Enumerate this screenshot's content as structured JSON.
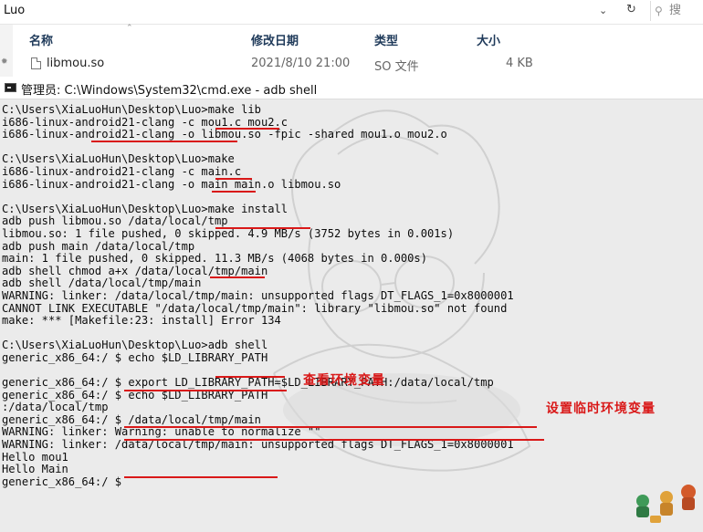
{
  "explorer": {
    "path": "Luo",
    "search_placeholder": "搜",
    "columns": {
      "name": "名称",
      "modified": "修改日期",
      "type": "类型",
      "size": "大小"
    },
    "file": {
      "name": "libmou.so",
      "modified": "2021/8/10 21:00",
      "type": "SO 文件",
      "size": "4 KB"
    }
  },
  "cmd": {
    "title": "管理员: C:\\Windows\\System32\\cmd.exe - adb  shell",
    "lines": [
      "C:\\Users\\XiaLuoHun\\Desktop\\Luo>make lib",
      "i686-linux-android21-clang -c mou1.c mou2.c",
      "i686-linux-android21-clang -o libmou.so -fpic -shared mou1.o mou2.o",
      "",
      "C:\\Users\\XiaLuoHun\\Desktop\\Luo>make",
      "i686-linux-android21-clang -c main.c",
      "i686-linux-android21-clang -o main main.o libmou.so",
      "",
      "C:\\Users\\XiaLuoHun\\Desktop\\Luo>make install",
      "adb push libmou.so /data/local/tmp",
      "libmou.so: 1 file pushed, 0 skipped. 4.9 MB/s (3752 bytes in 0.001s)",
      "adb push main /data/local/tmp",
      "main: 1 file pushed, 0 skipped. 11.3 MB/s (4068 bytes in 0.000s)",
      "adb shell chmod a+x /data/local/tmp/main",
      "adb shell /data/local/tmp/main",
      "WARNING: linker: /data/local/tmp/main: unsupported flags DT_FLAGS_1=0x8000001",
      "CANNOT LINK EXECUTABLE \"/data/local/tmp/main\": library \"libmou.so\" not found",
      "make: *** [Makefile:23: install] Error 134",
      "",
      "C:\\Users\\XiaLuoHun\\Desktop\\Luo>adb shell",
      "generic_x86_64:/ $ echo $LD_LIBRARY_PATH",
      "",
      "generic_x86_64:/ $ export LD_LIBRARY_PATH=$LD_LIBRARY_PATH:/data/local/tmp",
      "generic_x86_64:/ $ echo $LD_LIBRARY_PATH",
      ":/data/local/tmp",
      "generic_x86_64:/ $ /data/local/tmp/main",
      "WARNING: linker: Warning: unable to normalize \"\"",
      "WARNING: linker: /data/local/tmp/main: unsupported flags DT_FLAGS_1=0x8000001",
      "Hello mou1",
      "Hello Main",
      "generic_x86_64:/ $"
    ],
    "annotations": {
      "view_env": "查看环境变量",
      "set_temp_env": "设置临时环境变量"
    }
  },
  "colors": {
    "annotation": "#d91818",
    "console_bg": "#ebebeb",
    "header_text": "#1f3a5a"
  },
  "icons": [
    "chevron-down-icon",
    "refresh-icon",
    "search-icon",
    "pin-icon",
    "file-icon",
    "console-window-icon"
  ]
}
